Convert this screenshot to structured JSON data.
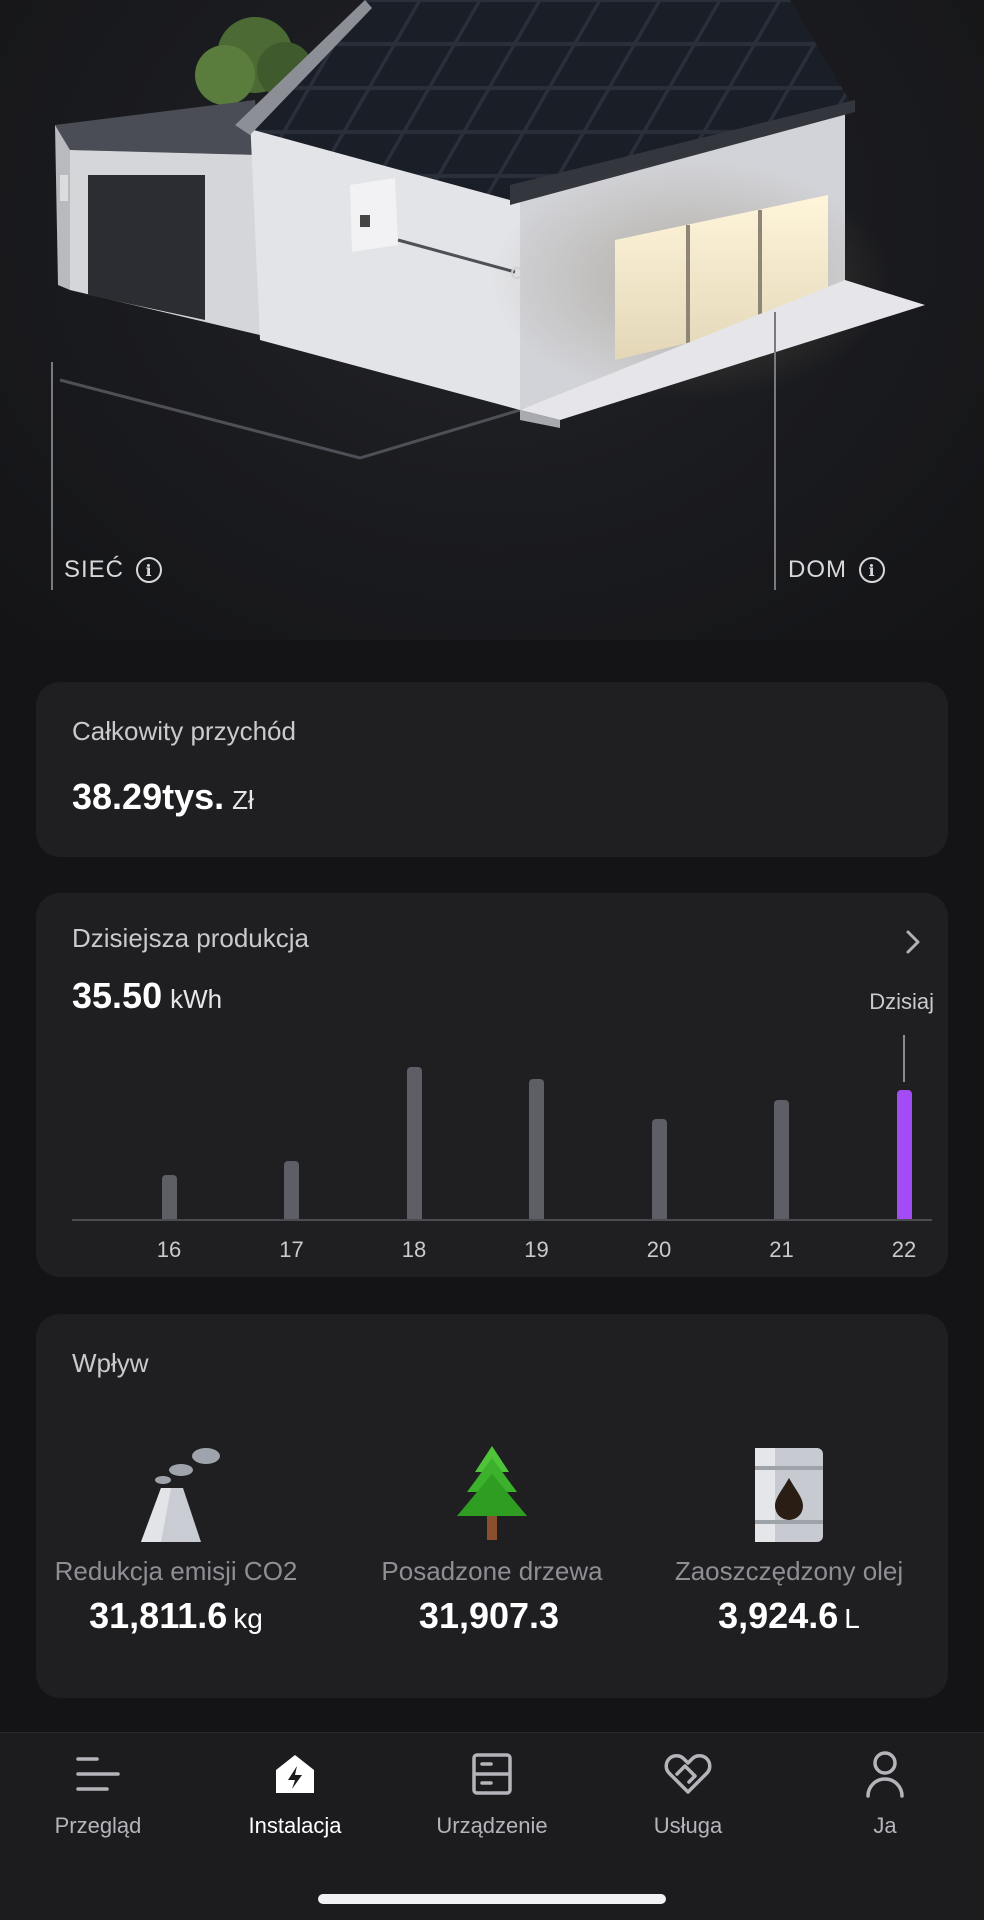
{
  "hero": {
    "grid_label": "SIEĆ",
    "home_label": "DOM"
  },
  "revenue": {
    "title": "Całkowity przychód",
    "value": "38.29tys.",
    "unit": "Zł"
  },
  "production": {
    "title": "Dzisiejsza produkcja",
    "value": "35.50",
    "unit": "kWh",
    "today_label": "Dzisiaj"
  },
  "chart_data": {
    "type": "bar",
    "categories": [
      "16",
      "17",
      "18",
      "19",
      "20",
      "21",
      "22"
    ],
    "values": [
      0.29,
      0.38,
      1.0,
      0.92,
      0.66,
      0.78,
      0.85
    ],
    "highlight_index": 6,
    "colors": {
      "bar": "#5d5e66",
      "highlight": "#a34cf5"
    }
  },
  "impact": {
    "title": "Wpływ",
    "items": [
      {
        "label": "Redukcja emisji CO2",
        "value": "31,811.6",
        "unit": "kg",
        "icon": "factory-icon"
      },
      {
        "label": "Posadzone drzewa",
        "value": "31,907.3",
        "unit": "",
        "icon": "tree-icon"
      },
      {
        "label": "Zaoszczędzony olej",
        "value": "3,924.6",
        "unit": "L",
        "icon": "oil-barrel-icon"
      }
    ]
  },
  "nav": {
    "items": [
      {
        "label": "Przegląd",
        "icon": "overview-icon"
      },
      {
        "label": "Instalacja",
        "icon": "installation-icon"
      },
      {
        "label": "Urządzenie",
        "icon": "device-icon"
      },
      {
        "label": "Usługa",
        "icon": "service-icon"
      },
      {
        "label": "Ja",
        "icon": "profile-icon"
      }
    ],
    "active_index": 1
  }
}
